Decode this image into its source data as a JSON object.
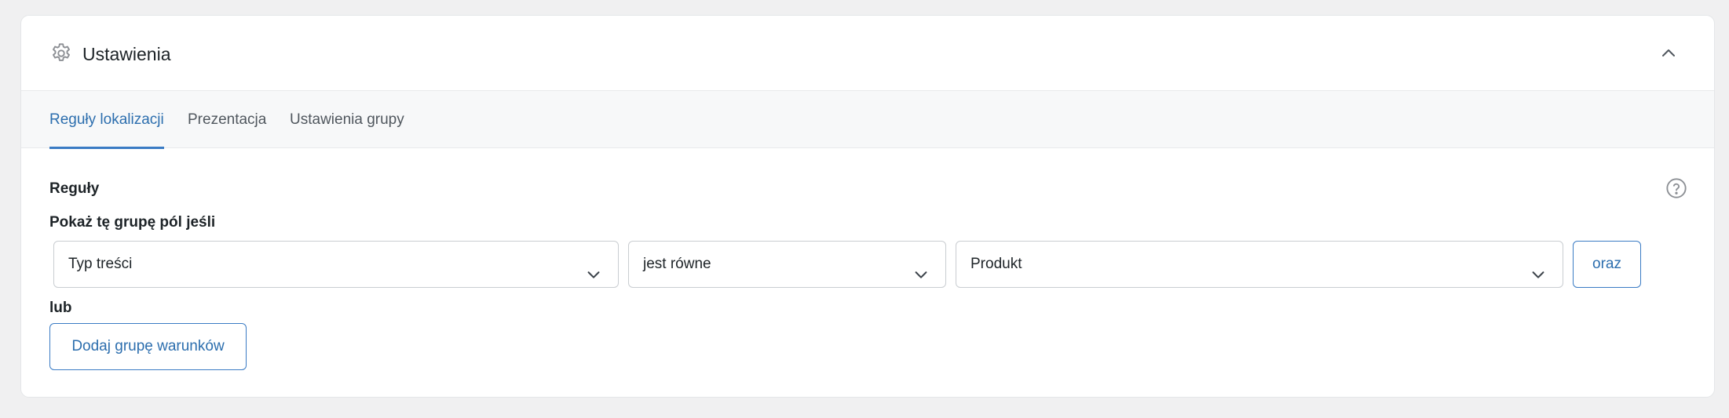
{
  "panel": {
    "title": "Ustawienia",
    "icon": "gear-icon",
    "collapse_icon": "chevron-up-icon"
  },
  "tabs": [
    {
      "label": "Reguły lokalizacji",
      "active": true
    },
    {
      "label": "Prezentacja",
      "active": false
    },
    {
      "label": "Ustawienia grupy",
      "active": false
    }
  ],
  "rules": {
    "section_label": "Reguły",
    "sub_label": "Pokaż tę grupę pól jeśli",
    "help_icon": "question-circle-icon",
    "condition": {
      "param": "Typ treści",
      "operator": "jest równe",
      "value": "Produkt",
      "and_label": "oraz"
    },
    "or_label": "lub",
    "add_group_label": "Dodaj grupę warunków"
  },
  "colors": {
    "accent": "#2c6eae",
    "tab_underline": "#3a7bc4",
    "background": "#f0f0f1",
    "panel": "#ffffff"
  }
}
